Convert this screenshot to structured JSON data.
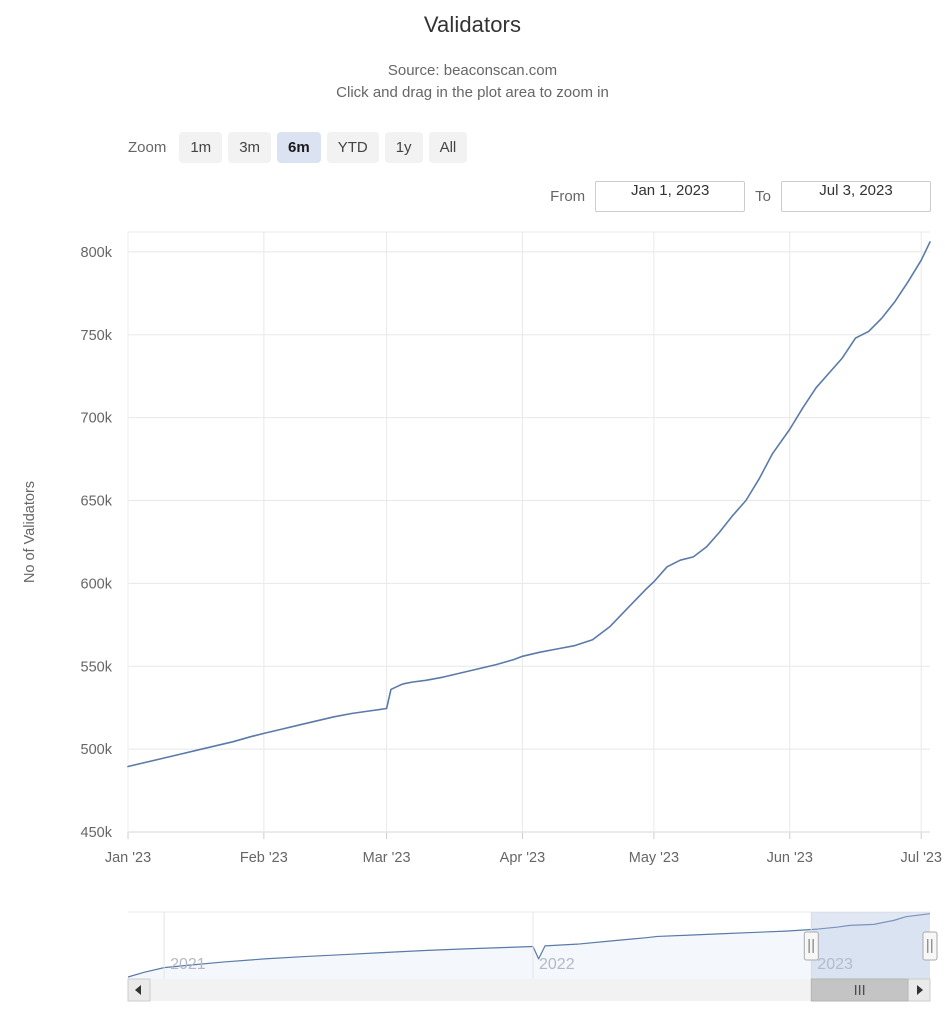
{
  "header": {
    "title": "Validators",
    "subtitle_source": "Source: beaconscan.com",
    "subtitle_hint": "Click and drag in the plot area to zoom in"
  },
  "range_selector": {
    "label": "Zoom",
    "buttons": [
      {
        "label": "1m",
        "selected": false
      },
      {
        "label": "3m",
        "selected": false
      },
      {
        "label": "6m",
        "selected": true
      },
      {
        "label": "YTD",
        "selected": false
      },
      {
        "label": "1y",
        "selected": false
      },
      {
        "label": "All",
        "selected": false
      }
    ],
    "from_label": "From",
    "from_value": "Jan 1, 2023",
    "to_label": "To",
    "to_value": "Jul 3, 2023"
  },
  "colors": {
    "series_line": "#5a7aa8",
    "gridline": "#e8e8e8",
    "selected_button_bg": "#dbe3f3",
    "button_bg": "#f2f2f2",
    "navigator_mask": "#b0c0e0",
    "navigator_area": "#f4f8fc",
    "text_muted": "#666666"
  },
  "navigator": {
    "year_labels": [
      "2021",
      "2022",
      "2023"
    ],
    "selected_from": "Jan 1, 2023",
    "selected_to": "Jul 3, 2023",
    "scroll_left_arrow": "◄",
    "scroll_right_arrow": "►",
    "grip_glyph": "|||"
  },
  "chart_data": {
    "type": "line",
    "title": "Validators",
    "subtitle": "Source: beaconscan.com",
    "xlabel": "",
    "ylabel": "No of Validators",
    "ylim": [
      450000,
      812000
    ],
    "ytick_labels": [
      "450k",
      "500k",
      "550k",
      "600k",
      "650k",
      "700k",
      "750k",
      "800k"
    ],
    "ytick_values": [
      450000,
      500000,
      550000,
      600000,
      650000,
      700000,
      750000,
      800000
    ],
    "xtick_labels": [
      "Jan '23",
      "Feb '23",
      "Mar '23",
      "Apr '23",
      "May '23",
      "Jun '23",
      "Jul '23"
    ],
    "xtick_positions": [
      0,
      31,
      59,
      90,
      120,
      151,
      181
    ],
    "xlim_days": [
      0,
      183
    ],
    "grid": true,
    "legend": false,
    "series": [
      {
        "name": "No of Validators",
        "color": "#5a7aa8",
        "x_days": [
          0,
          4,
          8,
          12,
          16,
          20,
          24,
          28,
          31,
          35,
          39,
          43,
          47,
          51,
          55,
          59,
          60,
          62,
          63,
          65,
          68,
          72,
          76,
          80,
          84,
          88,
          90,
          94,
          98,
          102,
          106,
          110,
          114,
          118,
          120,
          123,
          126,
          129,
          132,
          135,
          138,
          141,
          144,
          147,
          151,
          154,
          157,
          160,
          163,
          166,
          169,
          172,
          175,
          178,
          181,
          183
        ],
        "values": [
          489500,
          492000,
          494500,
          497000,
          499500,
          502000,
          504500,
          507500,
          509500,
          512000,
          514500,
          517000,
          519500,
          521500,
          523000,
          524500,
          536000,
          538500,
          539500,
          540500,
          541500,
          543500,
          546000,
          548500,
          551000,
          554000,
          556000,
          558500,
          560500,
          562500,
          566000,
          574000,
          585000,
          596000,
          601000,
          610000,
          614000,
          616000,
          622000,
          631000,
          641000,
          650000,
          663000,
          678000,
          693000,
          706000,
          718000,
          727000,
          736000,
          748000,
          752000,
          760000,
          770000,
          782000,
          795000,
          806000
        ]
      }
    ],
    "navigator_series": {
      "name": "No of Validators (full range)",
      "color": "#5a7aa8",
      "x_frac": [
        0.0,
        0.02,
        0.045,
        0.07,
        0.12,
        0.17,
        0.22,
        0.27,
        0.32,
        0.37,
        0.42,
        0.47,
        0.505,
        0.512,
        0.52,
        0.56,
        0.6,
        0.645,
        0.66,
        0.7,
        0.74,
        0.78,
        0.82,
        0.86,
        0.885,
        0.9,
        0.93,
        0.955,
        0.97,
        1.0
      ],
      "y_frac": [
        0.03,
        0.1,
        0.17,
        0.2,
        0.255,
        0.3,
        0.335,
        0.365,
        0.395,
        0.425,
        0.45,
        0.47,
        0.485,
        0.3,
        0.495,
        0.52,
        0.565,
        0.615,
        0.635,
        0.655,
        0.675,
        0.695,
        0.715,
        0.745,
        0.775,
        0.8,
        0.815,
        0.875,
        0.93,
        0.975
      ],
      "selection_start_frac": 0.852,
      "selection_end_frac": 1.0
    }
  }
}
